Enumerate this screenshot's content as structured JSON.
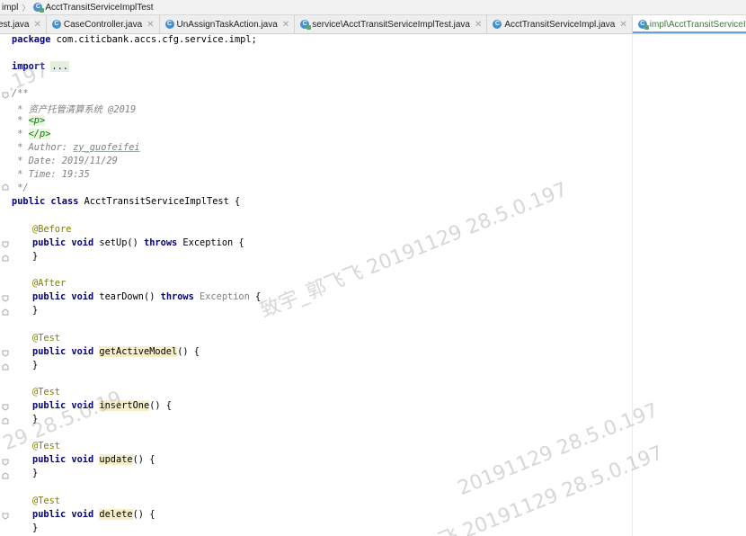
{
  "breadcrumb": {
    "items": [
      {
        "label": "impl",
        "icon": "folder-icon"
      },
      {
        "label": "AcctTransitServiceImplTest",
        "icon": "test-class-icon"
      }
    ]
  },
  "tabs": [
    {
      "label": "est.java",
      "icon": "",
      "active": false
    },
    {
      "label": "CaseController.java",
      "icon": "class-icon",
      "active": false
    },
    {
      "label": "UnAssignTaskAction.java",
      "icon": "class-icon",
      "active": false
    },
    {
      "label": "service\\AcctTransitServiceImplTest.java",
      "icon": "test-class-icon",
      "active": false
    },
    {
      "label": "AcctTransitServiceImpl.java",
      "icon": "class-icon",
      "active": false
    },
    {
      "label": "impl\\AcctTransitServiceImplTest.java",
      "icon": "test-class-icon",
      "active": true
    }
  ],
  "code": {
    "package_kw": "package",
    "package_name": " com.citicbank.accs.cfg.service.impl;",
    "import_kw": "import",
    "import_dots": "...",
    "doc_open": "/**",
    "doc_line1": " * 资产托管清算系统 @2019",
    "doc_p_prefix": " * ",
    "doc_p_open": "<p>",
    "doc_p_close": "</p>",
    "doc_author_prefix": " * Author: ",
    "doc_author_name": "zy_guofeifei",
    "doc_date": " * Date: 2019/11/29",
    "doc_time": " * Time: 19:35",
    "doc_close": " */",
    "class_kw": "public class",
    "class_name": " AcctTransitServiceImplTest {",
    "methods": [
      {
        "annotation": "@Before",
        "name": "setUp",
        "throws": true,
        "exception": "Exception",
        "exception_unused": false,
        "highlight": false
      },
      {
        "annotation": "@After",
        "name": "tearDown",
        "throws": true,
        "exception": "Exception",
        "exception_unused": true,
        "highlight": false
      },
      {
        "annotation": "@Test",
        "name": "getActiveModel",
        "throws": false,
        "exception": "",
        "exception_unused": false,
        "highlight": true
      },
      {
        "annotation": "@Test",
        "name": "insertOne",
        "throws": false,
        "exception": "",
        "exception_unused": false,
        "highlight": true
      },
      {
        "annotation": "@Test",
        "name": "update",
        "throws": false,
        "exception": "",
        "exception_unused": false,
        "highlight": true
      },
      {
        "annotation": "@Test",
        "name": "delete",
        "throws": false,
        "exception": "",
        "exception_unused": false,
        "highlight": true
      }
    ],
    "public_void": "public void",
    "throws_kw": "throws",
    "close_brace": "}"
  },
  "watermark": {
    "text_main": "致宇_郭飞飞 20191129 28.5.0.197",
    "text_top": ".197",
    "text_left": "29 28.5.0.19",
    "text_lower": "20191129 28.5.0.197",
    "text_bottom": "飞飞 20191129 28.5.0.197"
  }
}
